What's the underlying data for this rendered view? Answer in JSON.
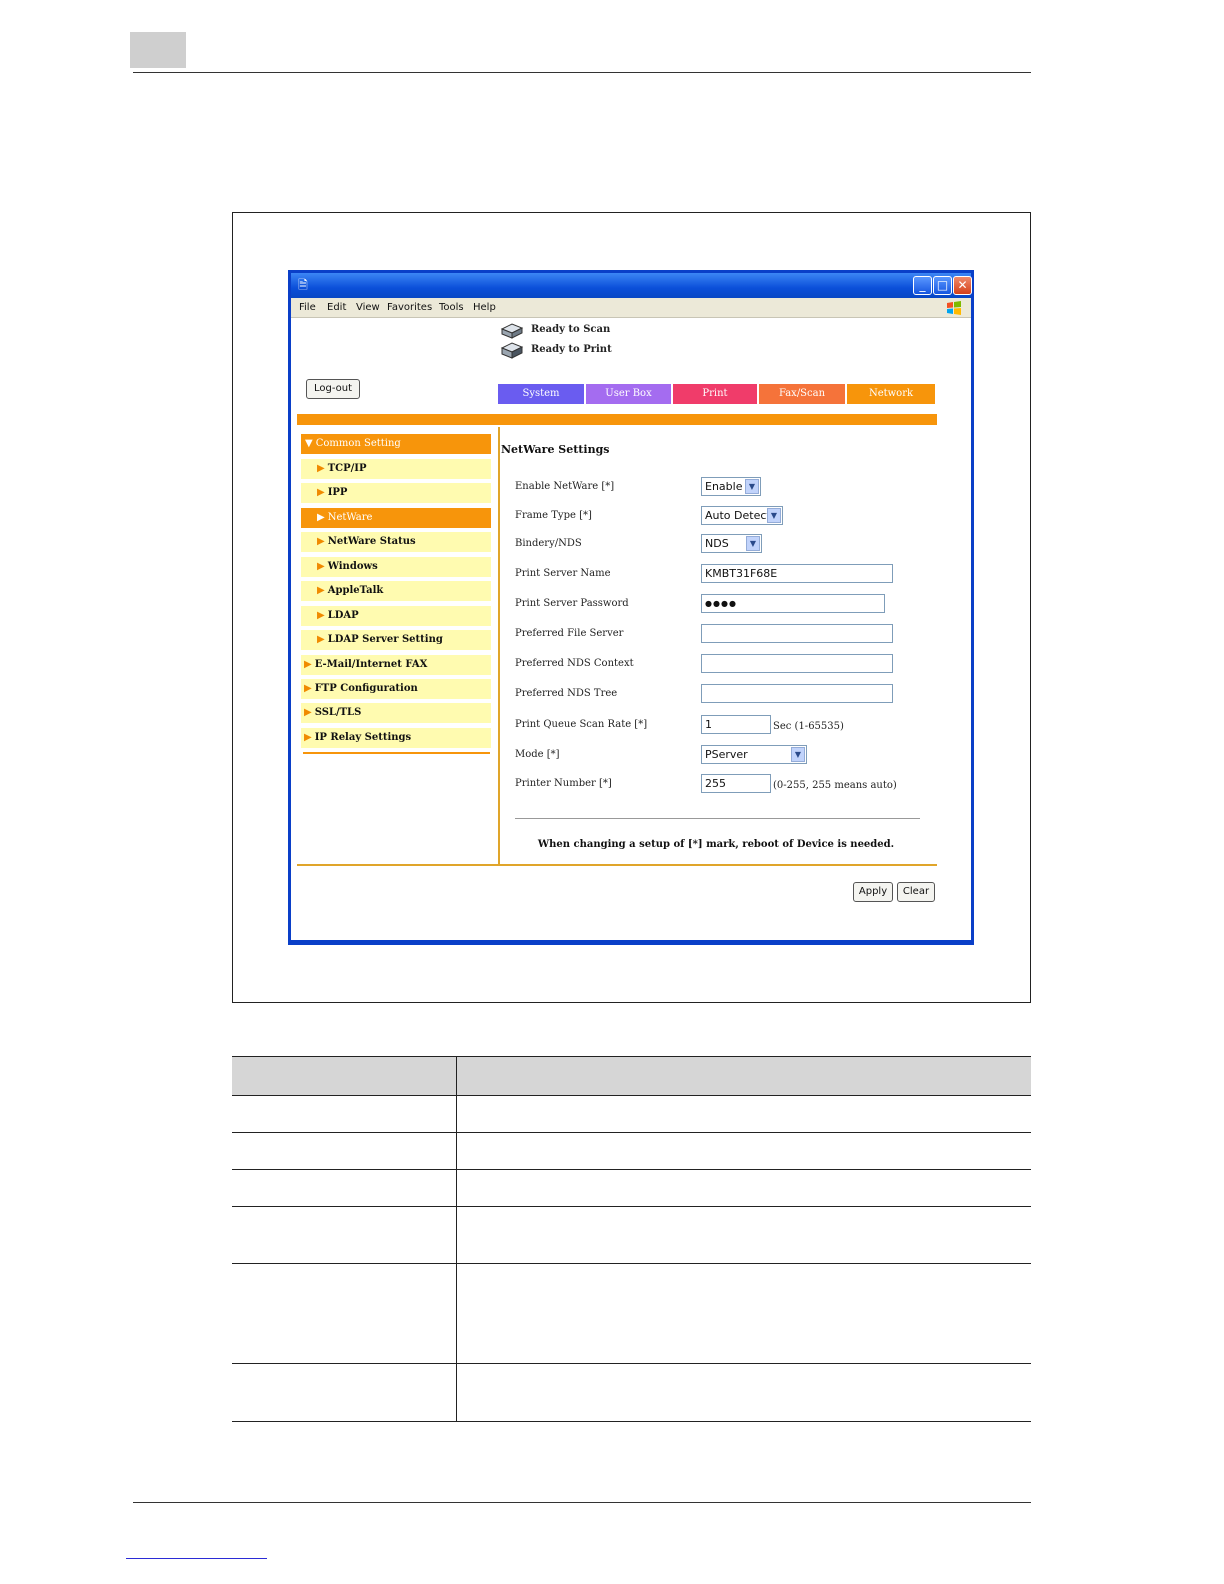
{
  "browser": {
    "menu": [
      "File",
      "Edit",
      "View",
      "Favorites",
      "Tools",
      "Help"
    ],
    "title_icon": "ie-page-icon",
    "window_buttons": [
      "minimize-icon",
      "maximize-icon",
      "close-icon"
    ]
  },
  "status": {
    "scan": "Ready to Scan",
    "print": "Ready to Print"
  },
  "logout_label": "Log-out",
  "tabs": [
    {
      "label": "System",
      "color": "#6a5cf0"
    },
    {
      "label": "User Box",
      "color": "#a46cf0"
    },
    {
      "label": "Print",
      "color": "#f03c6a"
    },
    {
      "label": "Fax/Scan",
      "color": "#f5733a"
    },
    {
      "label": "Network",
      "color": "#f7950b"
    }
  ],
  "nav": {
    "header": "Common Setting",
    "items": [
      {
        "label": "TCP/IP"
      },
      {
        "label": "IPP"
      },
      {
        "label": "NetWare"
      },
      {
        "label": "NetWare Status"
      },
      {
        "label": "Windows"
      },
      {
        "label": "AppleTalk"
      },
      {
        "label": "LDAP"
      },
      {
        "label": "LDAP Server Setting"
      },
      {
        "label": "E-Mail/Internet FAX"
      },
      {
        "label": "FTP Configuration"
      },
      {
        "label": "SSL/TLS"
      },
      {
        "label": "IP Relay Settings"
      }
    ]
  },
  "form": {
    "title": "NetWare Settings",
    "enable_netware": {
      "label": "Enable NetWare [*]",
      "value": "Enable"
    },
    "frame_type": {
      "label": "Frame Type [*]",
      "value": "Auto Detect"
    },
    "bindery_nds": {
      "label": "Bindery/NDS",
      "value": "NDS"
    },
    "print_server_name": {
      "label": "Print Server Name",
      "value": "KMBT31F68E"
    },
    "print_server_password": {
      "label": "Print Server Password",
      "value": "●●●●"
    },
    "preferred_file_server": {
      "label": "Preferred File Server",
      "value": ""
    },
    "preferred_nds_context": {
      "label": "Preferred NDS Context",
      "value": ""
    },
    "preferred_nds_tree": {
      "label": "Preferred NDS Tree",
      "value": ""
    },
    "print_queue_scan_rate": {
      "label": "Print Queue Scan Rate [*]",
      "value": "1",
      "hint": "Sec (1-65535)"
    },
    "mode": {
      "label": "Mode [*]",
      "value": "PServer"
    },
    "printer_number": {
      "label": "Printer Number [*]",
      "value": "255",
      "hint": "(0-255, 255 means auto)"
    },
    "reboot_note": "When changing a setup of [*] mark, reboot of Device is needed.",
    "apply_label": "Apply",
    "clear_label": "Clear"
  }
}
